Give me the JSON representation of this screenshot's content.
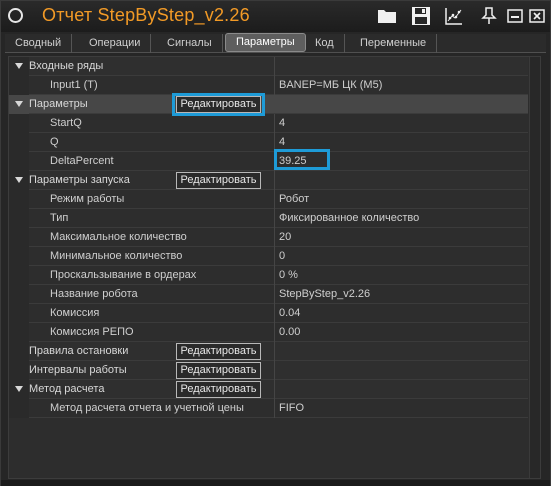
{
  "window": {
    "title": "Отчет StepByStep_v2.26"
  },
  "toolbar_icons": [
    "app-circle-icon",
    "folder-icon",
    "save-icon",
    "chart-icon",
    "pin-icon",
    "minimize-icon",
    "close-icon"
  ],
  "tabs": [
    {
      "label": "Сводный"
    },
    {
      "label": "Операции"
    },
    {
      "label": "Сигналы"
    },
    {
      "label": "Параметры",
      "active": true
    },
    {
      "label": "Код"
    },
    {
      "label": "Переменные"
    }
  ],
  "grid": {
    "edit_label": "Редактировать",
    "rows": [
      {
        "name": "Входные ряды",
        "value": "",
        "kind": "category",
        "arrow": true
      },
      {
        "name": "Input1 (T)",
        "value": "BANEP=МБ ЦК (M5)",
        "kind": "prop"
      },
      {
        "name": "Параметры",
        "value": "",
        "kind": "category",
        "arrow": true,
        "edit": true,
        "highlight": true
      },
      {
        "name": "StartQ",
        "value": "4",
        "kind": "prop"
      },
      {
        "name": "Q",
        "value": "4",
        "kind": "prop"
      },
      {
        "name": "DeltaPercent",
        "value": "39.25",
        "kind": "prop",
        "value_box": true
      },
      {
        "name": "Параметры запуска",
        "value": "",
        "kind": "category",
        "arrow": true,
        "edit": true
      },
      {
        "name": "Режим работы",
        "value": "Робот",
        "kind": "prop"
      },
      {
        "name": "Тип",
        "value": "Фиксированное количество",
        "kind": "prop"
      },
      {
        "name": "Максимальное количество",
        "value": "20",
        "kind": "prop"
      },
      {
        "name": "Минимальное количество",
        "value": "0",
        "kind": "prop"
      },
      {
        "name": "Проскальзывание в ордерах",
        "value": "0 %",
        "kind": "prop"
      },
      {
        "name": "Название робота",
        "value": "StepByStep_v2.26",
        "kind": "prop"
      },
      {
        "name": "Комиссия",
        "value": "0.04",
        "kind": "prop"
      },
      {
        "name": "Комиссия РЕПО",
        "value": "0.00",
        "kind": "prop"
      },
      {
        "name": "Правила остановки",
        "value": "",
        "kind": "category",
        "arrow": false,
        "edit": true
      },
      {
        "name": "Интервалы работы",
        "value": "",
        "kind": "category",
        "arrow": false,
        "edit": true
      },
      {
        "name": "Метод расчета",
        "value": "",
        "kind": "category",
        "arrow": true,
        "edit": true
      },
      {
        "name": "Метод расчета отчета и учетной цены",
        "value": "FIFO",
        "kind": "prop"
      }
    ]
  },
  "colors": {
    "title": "#f29a26",
    "highlight_box": "#1e9bd7",
    "background": "#262626"
  }
}
